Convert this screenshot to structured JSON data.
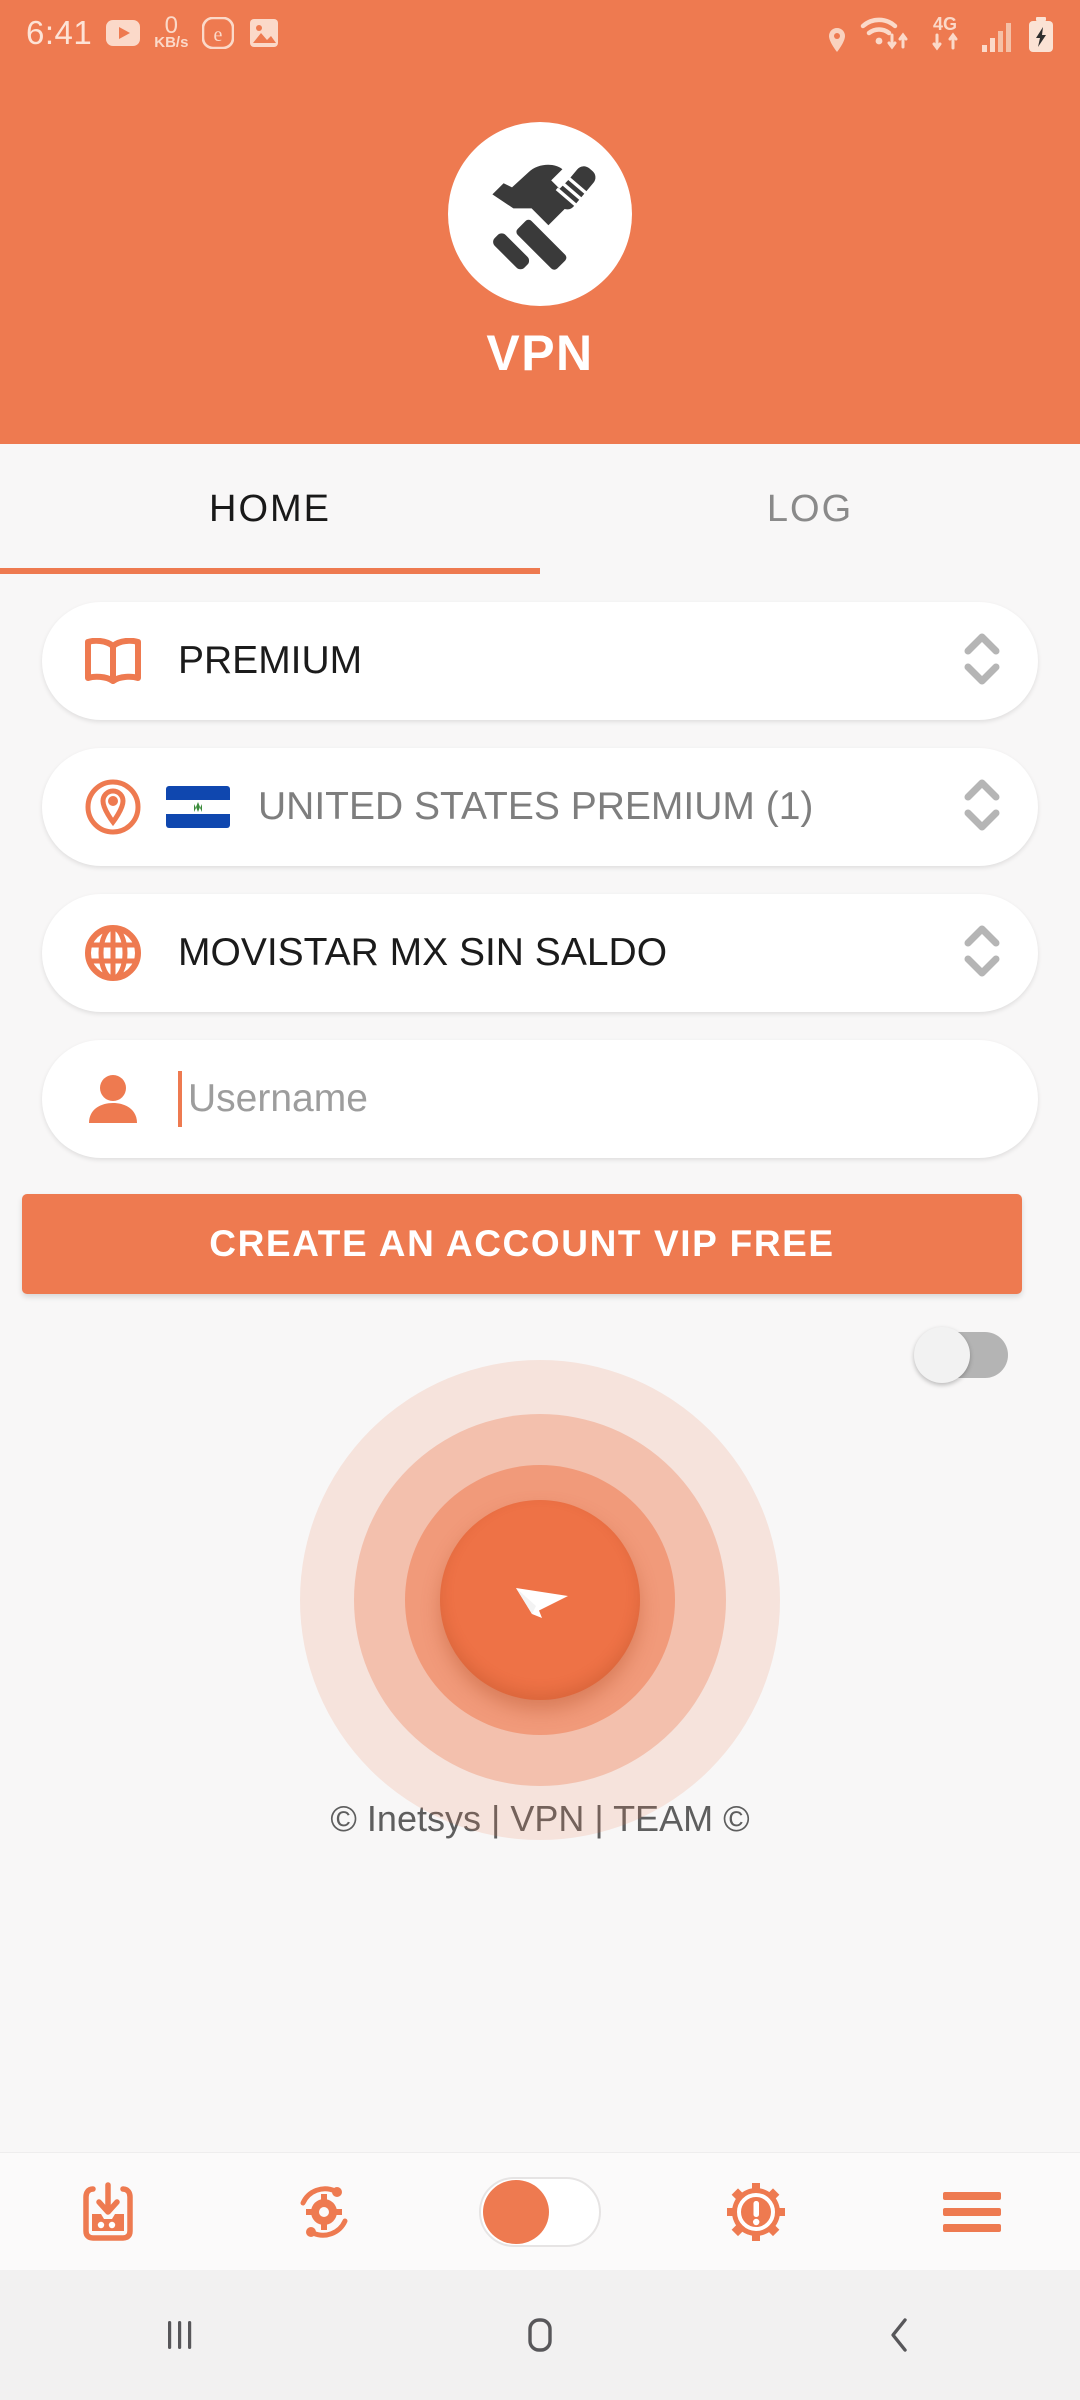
{
  "status_bar": {
    "time": "6:41",
    "net_speed_value": "0",
    "net_speed_unit": "KB/s",
    "left_icons": [
      "youtube-icon",
      "net-speed-indicator",
      "e-browser-icon",
      "gallery-icon"
    ],
    "right_icons": [
      "location-icon",
      "wifi-icon",
      "mobile-data-4g-icon",
      "signal-bars-icon",
      "battery-charging-icon"
    ],
    "network_type": "4G"
  },
  "header": {
    "app_title": "VPN",
    "logo_icon": "hammer-and-screwdriver-icon",
    "background_color": "#ee7a50"
  },
  "tabs": [
    {
      "label": "HOME",
      "active": true
    },
    {
      "label": "LOG",
      "active": false
    }
  ],
  "rows": [
    {
      "icon": "open-book-icon",
      "label": "PREMIUM",
      "muted": false,
      "has_flag": false,
      "spinner": "up-down-chevrons-icon"
    },
    {
      "icon": "location-pin-target-icon",
      "label": "UNITED STATES PREMIUM (1)",
      "muted": true,
      "has_flag": true,
      "flag": "el-salvador-flag",
      "spinner": "up-down-chevrons-icon"
    },
    {
      "icon": "globe-icon",
      "label": "MOVISTAR MX SIN SALDO",
      "muted": false,
      "has_flag": false,
      "spinner": "up-down-chevrons-icon"
    }
  ],
  "username_field": {
    "icon": "person-icon",
    "value": "",
    "placeholder": "Username"
  },
  "cta_button": {
    "label": "CREATE AN ACCOUNT VIP FREE"
  },
  "main_toggle": {
    "name": "vpn-power-toggle",
    "state": "off"
  },
  "connect_button": {
    "icon": "paper-plane-send-icon",
    "state": "disconnected",
    "ripple_count": 3
  },
  "footer": {
    "credit": "© Inetsys | VPN | TEAM ©"
  },
  "toolbar": [
    {
      "name": "import-config-button",
      "icon": "inbox-download-icon"
    },
    {
      "name": "refresh-settings-button",
      "icon": "gear-refresh-icon"
    },
    {
      "name": "toolbar-toggle",
      "icon": "toggle-switch-on-icon",
      "state": "on"
    },
    {
      "name": "settings-alert-button",
      "icon": "gear-exclamation-icon"
    },
    {
      "name": "menu-button",
      "icon": "hamburger-menu-icon"
    }
  ],
  "navbar": [
    {
      "name": "recents-button",
      "icon": "recents-icon"
    },
    {
      "name": "home-button",
      "icon": "home-square-icon"
    },
    {
      "name": "back-button",
      "icon": "back-chevron-icon"
    }
  ],
  "colors": {
    "accent": "#ee7a50",
    "accent_dark": "#ee7246",
    "background": "#f8f7f7",
    "text_primary": "#1b1b1b",
    "text_muted": "#7e7e7e"
  }
}
